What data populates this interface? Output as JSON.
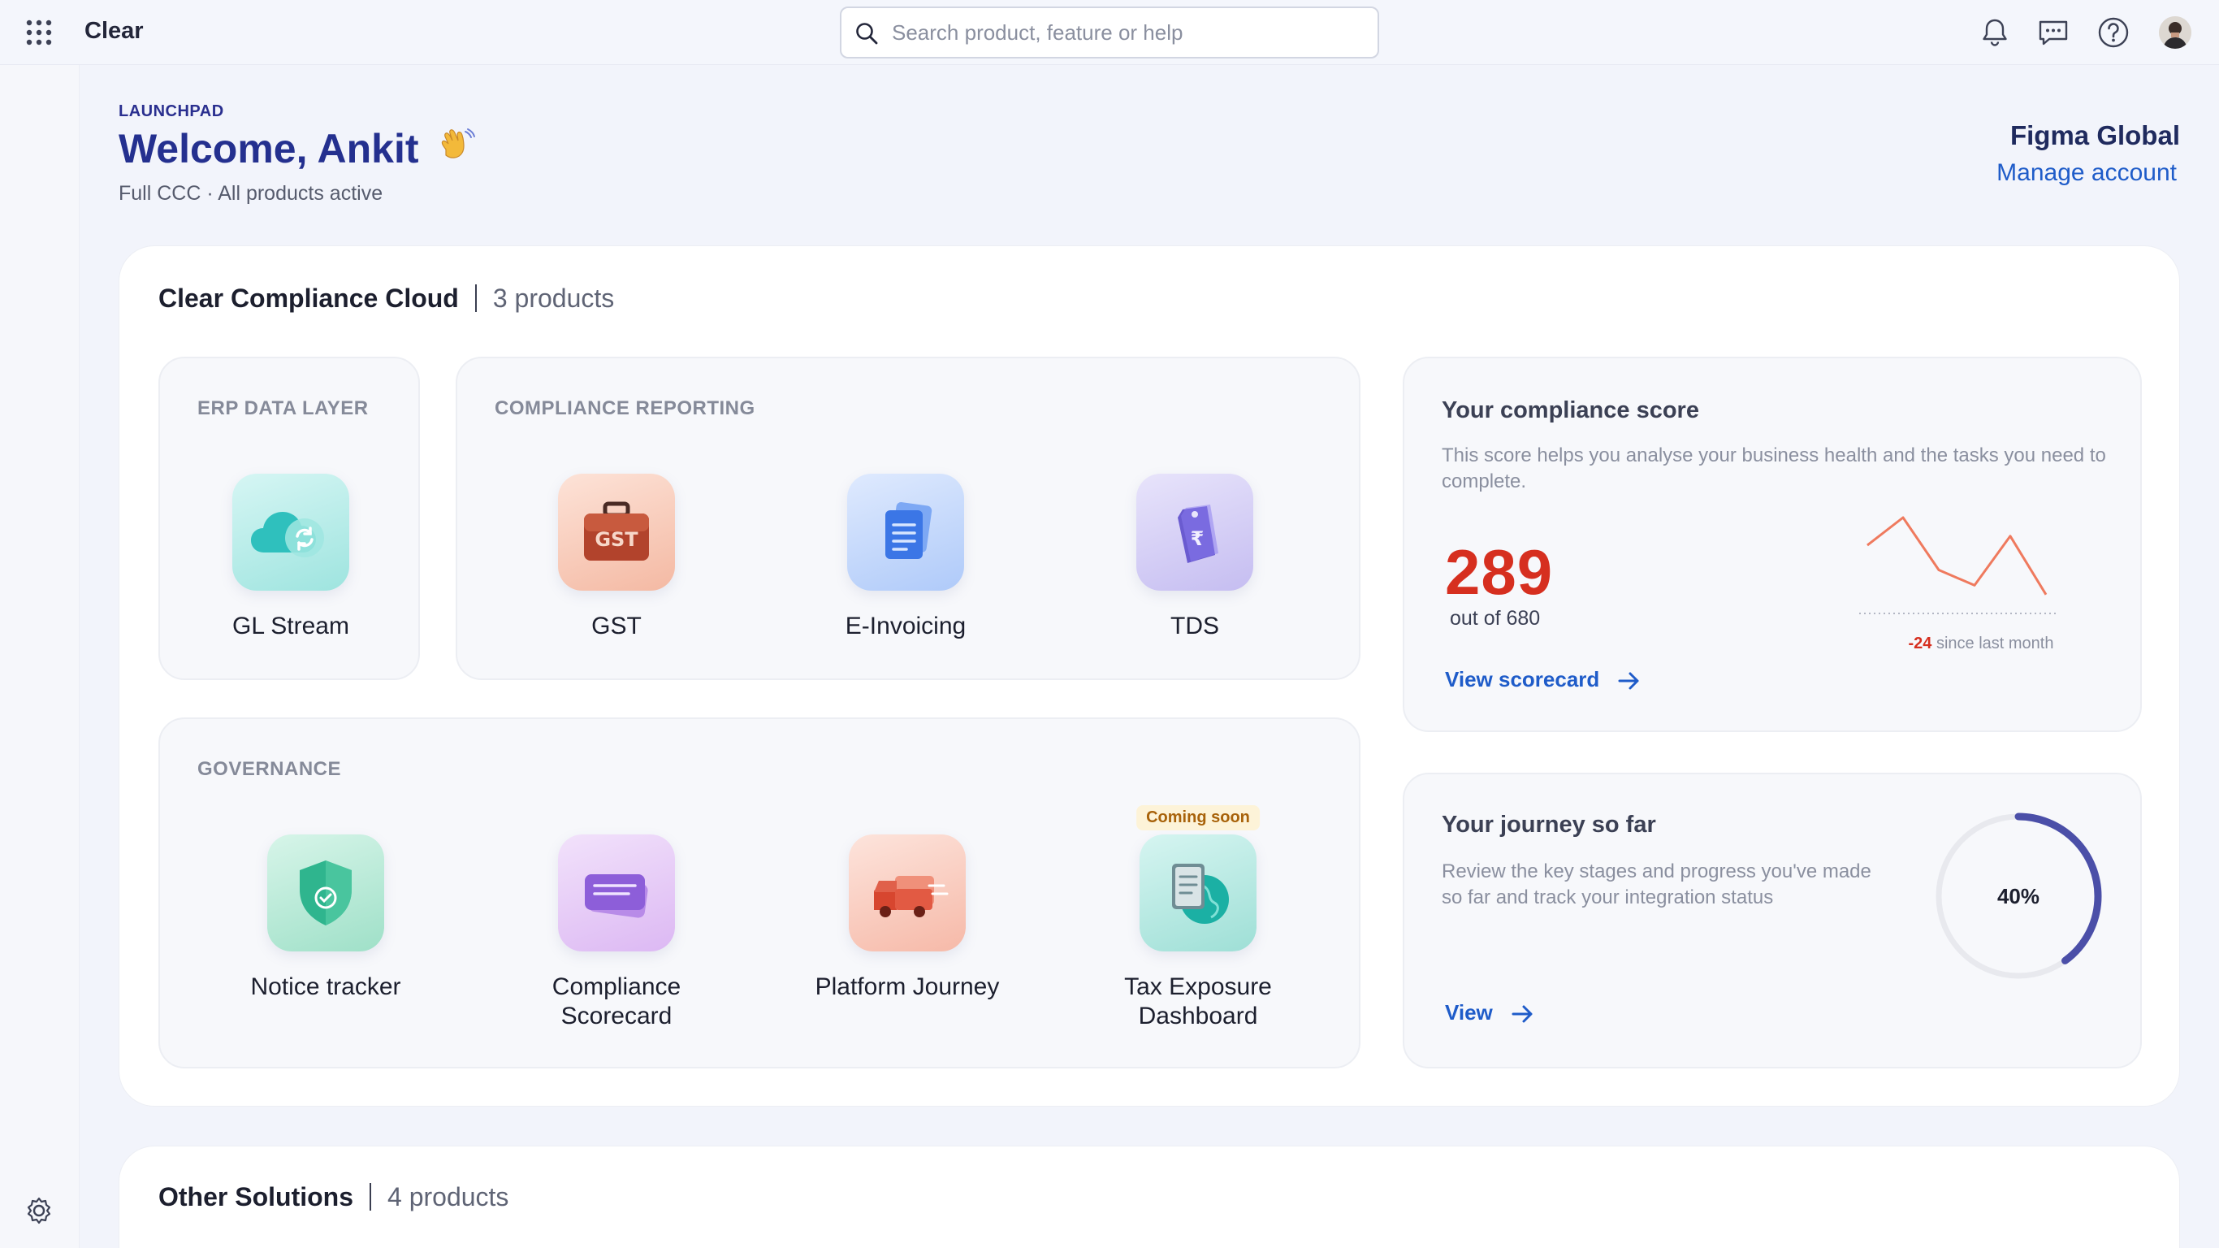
{
  "app": {
    "title": "Clear"
  },
  "search": {
    "placeholder": "Search product, feature or help"
  },
  "header": {
    "eyebrow": "LAUNCHPAD",
    "welcome": "Welcome, Ankit",
    "subtitle": "Full CCC · All products active",
    "account_name": "Figma Global",
    "manage_account": "Manage account"
  },
  "compliance_cloud": {
    "title": "Clear Compliance Cloud",
    "count": "3 products",
    "groups": [
      {
        "label": "ERP DATA LAYER",
        "products": [
          {
            "name": "GL Stream",
            "icon": "cloud-sync-icon"
          }
        ]
      },
      {
        "label": "COMPLIANCE REPORTING",
        "products": [
          {
            "name": "GST",
            "icon": "gst-briefcase-icon"
          },
          {
            "name": "E-Invoicing",
            "icon": "document-icon"
          },
          {
            "name": "TDS",
            "icon": "rupee-tag-icon"
          }
        ]
      },
      {
        "label": "GOVERNANCE",
        "products": [
          {
            "name": "Notice tracker",
            "icon": "shield-check-icon"
          },
          {
            "name": "Compliance Scorecard",
            "icon": "card-icon"
          },
          {
            "name": "Platform Journey",
            "icon": "truck-icon"
          },
          {
            "name": "Tax Exposure Dashboard",
            "icon": "globe-document-icon",
            "badge": "Coming soon"
          }
        ]
      }
    ]
  },
  "score_card": {
    "title": "Your compliance score",
    "description": "This score helps you analyse your business health and the tasks you need to complete.",
    "score": "289",
    "out_of": "out of 680",
    "delta": "-24",
    "delta_text": "since last month",
    "link": "View scorecard",
    "trend": [
      40,
      58,
      24,
      14,
      46,
      8
    ]
  },
  "journey_card": {
    "title": "Your journey so far",
    "description": "Review the key stages and progress you've made so far and track your integration status",
    "progress": 0.4,
    "progress_label": "40%",
    "link": "View"
  },
  "other_solutions": {
    "title": "Other Solutions",
    "count": "4 products"
  },
  "colors": {
    "accent": "#1f5cc9",
    "brand": "#24308f",
    "alert": "#d62f1f",
    "progress": "#4b4fa8"
  }
}
